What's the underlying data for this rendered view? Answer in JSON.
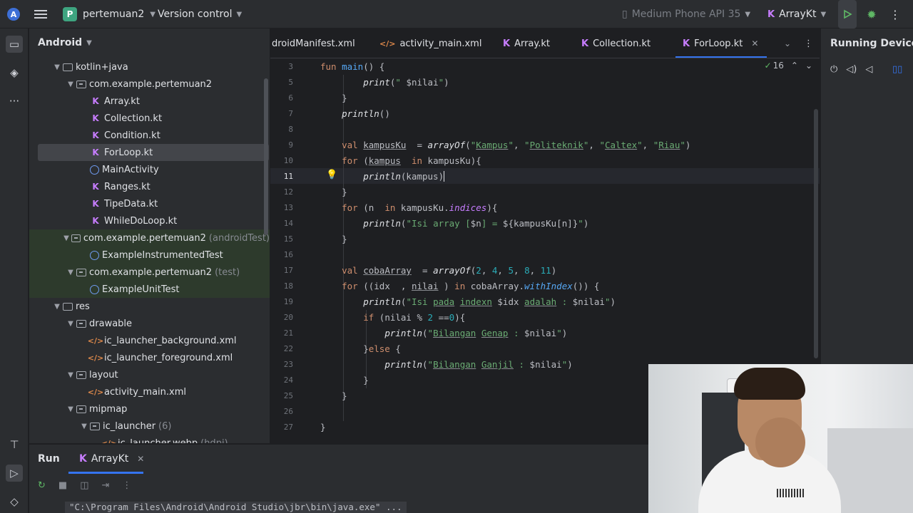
{
  "topbar": {
    "logo_letter": "A",
    "project_badge": "P",
    "project_name": "pertemuan2",
    "version_control": "Version control",
    "device": "Medium Phone API 35",
    "run_config": "ArrayKt"
  },
  "project_panel": {
    "title": "Android",
    "tree": [
      {
        "label": "kotlin+java",
        "icon": "folder-icon",
        "level": 2,
        "expanded": true
      },
      {
        "label": "com.example.pertemuan2",
        "icon": "package-icon",
        "level": 3,
        "expanded": true
      },
      {
        "label": "Array.kt",
        "icon": "kotlin-file-icon",
        "level": 4
      },
      {
        "label": "Collection.kt",
        "icon": "kotlin-file-icon",
        "level": 4
      },
      {
        "label": "Condition.kt",
        "icon": "kotlin-file-icon",
        "level": 4
      },
      {
        "label": "ForLoop.kt",
        "icon": "kotlin-file-icon",
        "level": 4,
        "selected": true
      },
      {
        "label": "MainActivity",
        "icon": "activity-icon",
        "level": 4
      },
      {
        "label": "Ranges.kt",
        "icon": "kotlin-file-icon",
        "level": 4
      },
      {
        "label": "TipeData.kt",
        "icon": "kotlin-file-icon",
        "level": 4
      },
      {
        "label": "WhileDoLoop.kt",
        "icon": "kotlin-file-icon",
        "level": 4
      },
      {
        "label": "com.example.pertemuan2",
        "suffix": "(androidTest)",
        "icon": "package-icon",
        "level": 3,
        "expanded": true,
        "highlight": true
      },
      {
        "label": "ExampleInstrumentedTest",
        "icon": "activity-icon",
        "level": 4,
        "highlight": true
      },
      {
        "label": "com.example.pertemuan2",
        "suffix": "(test)",
        "icon": "package-icon",
        "level": 3,
        "expanded": true,
        "highlight": true
      },
      {
        "label": "ExampleUnitTest",
        "icon": "activity-icon",
        "level": 4,
        "highlight": true
      },
      {
        "label": "res",
        "icon": "folder-icon",
        "level": 2,
        "expanded": true
      },
      {
        "label": "drawable",
        "icon": "package-icon",
        "level": 3,
        "expanded": true
      },
      {
        "label": "ic_launcher_background.xml",
        "icon": "xml-file-icon",
        "level": 4
      },
      {
        "label": "ic_launcher_foreground.xml",
        "icon": "xml-file-icon",
        "level": 4
      },
      {
        "label": "layout",
        "icon": "package-icon",
        "level": 3,
        "expanded": true
      },
      {
        "label": "activity_main.xml",
        "icon": "xml-file-icon",
        "level": 4
      },
      {
        "label": "mipmap",
        "icon": "package-icon",
        "level": 3,
        "expanded": true
      },
      {
        "label": "ic_launcher",
        "suffix": "(6)",
        "icon": "package-icon",
        "level": 4,
        "expanded": true
      },
      {
        "label": "ic_launcher.webp",
        "suffix": "(hdpi)",
        "icon": "xml-file-icon",
        "level": 5
      }
    ]
  },
  "tabs": [
    {
      "label": "droidManifest.xml",
      "type": "xml"
    },
    {
      "label": "activity_main.xml",
      "type": "xml"
    },
    {
      "label": "Array.kt",
      "type": "kt"
    },
    {
      "label": "Collection.kt",
      "type": "kt"
    },
    {
      "label": "ForLoop.kt",
      "type": "kt",
      "active": true
    }
  ],
  "editor": {
    "inspection_count": "16",
    "line_numbers": [
      "3",
      "5",
      "6",
      "7",
      "8",
      "9",
      "10",
      "11",
      "12",
      "13",
      "14",
      "15",
      "16",
      "17",
      "18",
      "19",
      "20",
      "21",
      "22",
      "23",
      "24",
      "25",
      "26",
      "27"
    ],
    "current_line": "11"
  },
  "running_devices": {
    "title": "Running Devices"
  },
  "run_panel": {
    "label": "Run",
    "tab": "ArrayKt",
    "command": "\"C:\\Program Files\\Android\\Android Studio\\jbr\\bin\\java.exe\" ..."
  }
}
